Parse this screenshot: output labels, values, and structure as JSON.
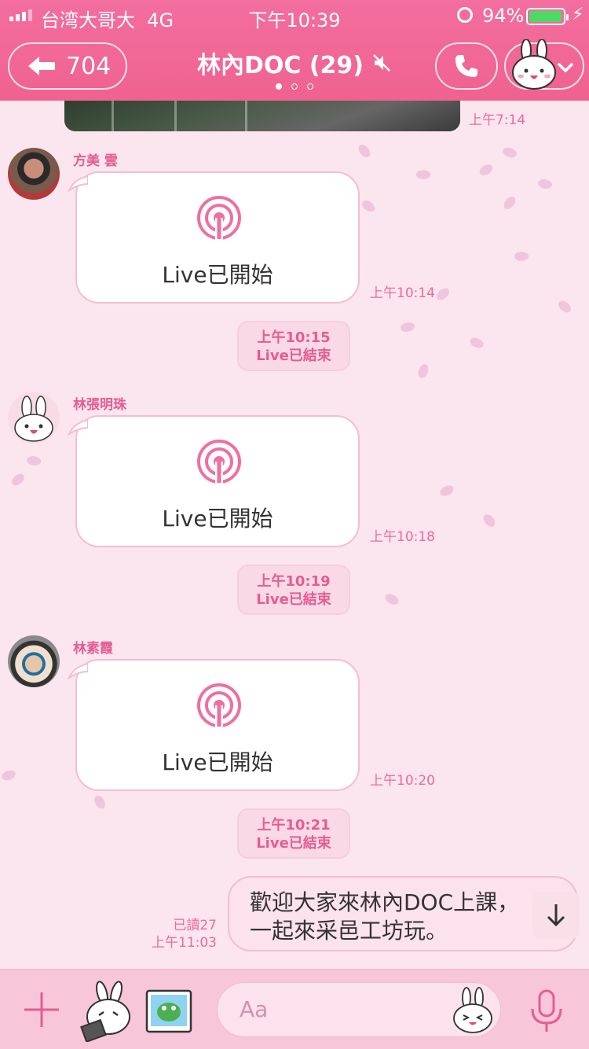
{
  "status_bar": {
    "carrier": "台湾大哥大",
    "network": "4G",
    "time": "下午10:39",
    "battery_percent": "94%",
    "battery_level": 0.94,
    "colors": {
      "battery_fill": "#4cd964"
    }
  },
  "header": {
    "back_count": "704",
    "title": "林內DOC (29)",
    "page_indicator": {
      "count": 3,
      "active": 0
    },
    "icons": [
      "back-arrow-icon",
      "mute-icon",
      "phone-icon",
      "bunny-avatar-icon",
      "chevron-down-icon"
    ]
  },
  "chat": {
    "top_image_time": "上午7:14",
    "messages": [
      {
        "sender": "方美 雲",
        "card_label": "Live已開始",
        "time": "上午10:14"
      },
      {
        "sender": "林張明珠",
        "card_label": "Live已開始",
        "time": "上午10:18"
      },
      {
        "sender": "林素霞",
        "card_label": "Live已開始",
        "time": "上午10:20"
      }
    ],
    "system_notes": [
      {
        "time": "上午10:15",
        "text": "Live已結束"
      },
      {
        "time": "上午10:19",
        "text": "Live已結束"
      },
      {
        "time": "上午10:21",
        "text": "Live已結束"
      }
    ],
    "my_message": {
      "line1": "歡迎大家來林內DOC上課，",
      "line2": "一起來采邑工坊玩。",
      "read": "已讀27",
      "time": "上午11:03"
    }
  },
  "input_bar": {
    "placeholder": "Aa",
    "icons": [
      "plus-icon",
      "sticker-icon",
      "photo-icon",
      "emoji-icon",
      "mic-icon"
    ]
  },
  "colors": {
    "header": "#f0628f",
    "accent": "#e55c92",
    "chat_background": "#fbe6ef",
    "bubble_border": "#f5bcd2",
    "input_bar": "#f7c6d8"
  }
}
